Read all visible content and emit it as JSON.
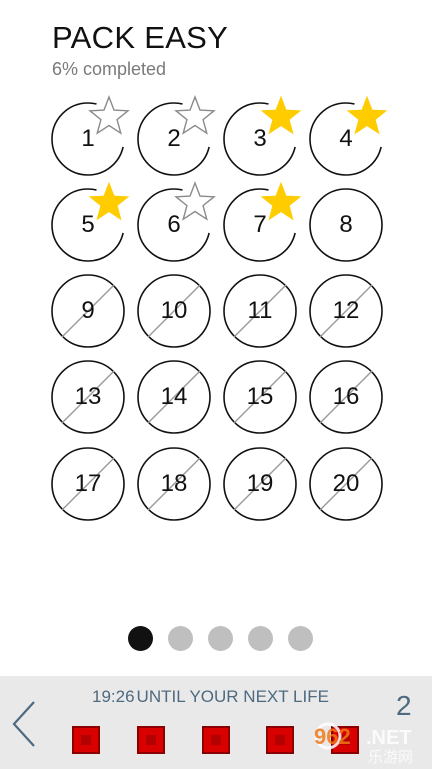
{
  "header": {
    "title": "PACK EASY",
    "progress": "6% completed"
  },
  "levels": [
    {
      "number": "1",
      "state": "star-empty"
    },
    {
      "number": "2",
      "state": "star-empty"
    },
    {
      "number": "3",
      "state": "star-gold"
    },
    {
      "number": "4",
      "state": "star-gold"
    },
    {
      "number": "5",
      "state": "star-gold"
    },
    {
      "number": "6",
      "state": "star-empty"
    },
    {
      "number": "7",
      "state": "star-gold"
    },
    {
      "number": "8",
      "state": "unlocked"
    },
    {
      "number": "9",
      "state": "locked"
    },
    {
      "number": "10",
      "state": "locked"
    },
    {
      "number": "11",
      "state": "locked"
    },
    {
      "number": "12",
      "state": "locked"
    },
    {
      "number": "13",
      "state": "locked"
    },
    {
      "number": "14",
      "state": "locked"
    },
    {
      "number": "15",
      "state": "locked"
    },
    {
      "number": "16",
      "state": "locked"
    },
    {
      "number": "17",
      "state": "locked"
    },
    {
      "number": "18",
      "state": "locked"
    },
    {
      "number": "19",
      "state": "locked"
    },
    {
      "number": "20",
      "state": "locked"
    }
  ],
  "pager": {
    "page_count": 5,
    "current_page": 1
  },
  "footer": {
    "timer": "19:26",
    "timer_text": "UNTIL YOUR NEXT LIFE",
    "lives_count": "2",
    "life_icons": 5
  },
  "watermark": {
    "text": "962.NET 乐游网"
  },
  "colors": {
    "star_gold": "#ffcc00",
    "star_outline": "#8a8a8a",
    "ring": "#111111",
    "life": "#d90000",
    "accent_text": "#4e6a80",
    "pager_active": "#111111",
    "pager_inactive": "#bfbfbf"
  }
}
